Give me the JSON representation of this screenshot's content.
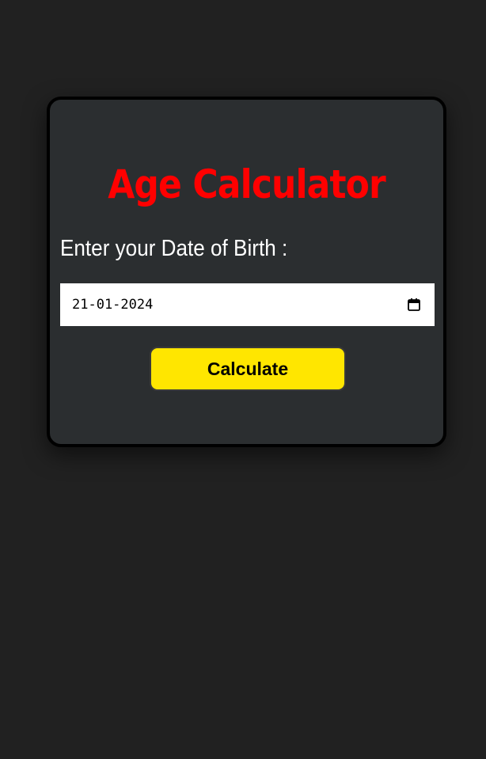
{
  "app": {
    "title": "Age Calculator"
  },
  "form": {
    "dob_label": "Enter your Date of Birth :",
    "dob_value": "21-01-2024",
    "calendar_icon": "calendar-icon",
    "calculate_label": "Calculate"
  },
  "colors": {
    "page_background": "#212121",
    "card_background": "#2b2e30",
    "title": "#ff0000",
    "button": "#ffe600"
  }
}
